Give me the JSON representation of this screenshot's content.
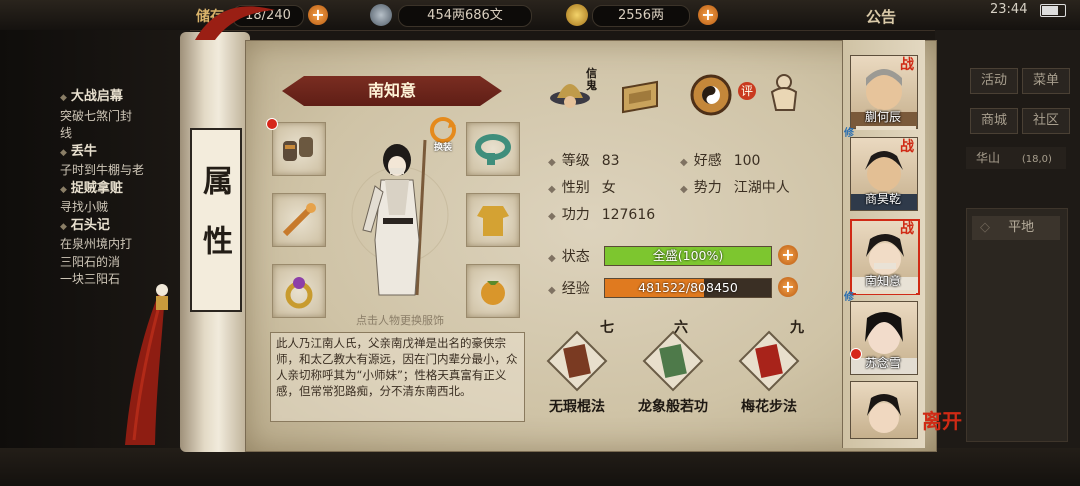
{
  "topbar": {
    "bag_label": "储存",
    "bag_count": "18/240",
    "silver": "454两686文",
    "gold": "2556两",
    "notice": "公告",
    "clock": "23:44"
  },
  "quests": [
    {
      "title": "大战启幕",
      "desc1": "突破七煞门封",
      "desc2": "线"
    },
    {
      "title": "丢牛",
      "desc1": "子时到牛棚与老",
      "desc2": ""
    },
    {
      "title": "捉贼拿赃",
      "desc1": "寻找小贼",
      "desc2": ""
    },
    {
      "title": "石头记",
      "desc1": "在泉州境内打",
      "desc2": "三阳石的消",
      "desc3": "一块三阳石"
    }
  ],
  "right_menu": {
    "activity": "活动",
    "menu": "菜单",
    "shop": "商城",
    "community": "社区",
    "location": "华山",
    "location_coord": "(18,0)",
    "terrain": "平地"
  },
  "scroll_label": "属性",
  "character": {
    "name": "南知意",
    "review_badge": "评",
    "swap_label": "换装",
    "hint": "点击人物更换服饰",
    "description": "此人乃江南人氏，父亲南戊禅是出名的豪侠宗师，和太乙教大有源远，因在门内辈分最小，众人亲切称呼其为“小师妹”；性格天真富有正义感，但常常犯路痴，分不清东南西北。"
  },
  "stat_icons": [
    {
      "name": "信鬼",
      "icon": "hat-icon"
    },
    {
      "name": "",
      "icon": "scroll-box-icon"
    },
    {
      "name": "",
      "icon": "taiji-icon"
    },
    {
      "name": "",
      "icon": "figure-icon"
    }
  ],
  "stats": {
    "level_label": "等级",
    "level": "83",
    "favor_label": "好感",
    "favor": "100",
    "gender_label": "性别",
    "gender": "女",
    "faction_label": "势力",
    "faction": "江湖中人",
    "power_label": "功力",
    "power": "127616",
    "status_label": "状态",
    "status_text": "全盛(100%)",
    "status_fraction": 1.0,
    "exp_label": "经验",
    "exp_text": "481522/808450",
    "exp_fraction": 0.5956
  },
  "skills": [
    {
      "level": "七",
      "name": "无瑕棍法"
    },
    {
      "level": "六",
      "name": "龙象般若功"
    },
    {
      "level": "九",
      "name": "梅花步法"
    }
  ],
  "party": [
    {
      "name": "蒯何辰",
      "battle": "战",
      "tag": "修"
    },
    {
      "name": "商昊乾",
      "battle": "战",
      "tag": ""
    },
    {
      "name": "南知意",
      "battle": "战",
      "tag": "修"
    },
    {
      "name": "苏念雪",
      "battle": "",
      "tag": ""
    },
    {
      "name": "",
      "battle": "",
      "tag": ""
    }
  ],
  "leave_label": "离开",
  "colors": {
    "status_bar": "#7dc62f",
    "exp_bar": "#e07a1f",
    "name_banner": "#6c261b",
    "accent_red": "#d02a15"
  }
}
